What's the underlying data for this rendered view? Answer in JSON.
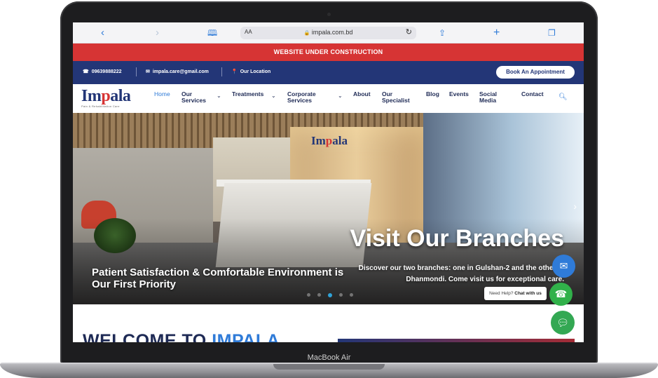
{
  "browser": {
    "text_size_label": "AA",
    "url": "impala.com.bd"
  },
  "banner": {
    "text": "WEBSITE UNDER CONSTRUCTION"
  },
  "infobar": {
    "phone": "09639888222",
    "email": "impala.care@gmail.com",
    "location": "Our Location",
    "book_button": "Book An Appointment"
  },
  "logo": {
    "name_prefix": "Im",
    "name_accent": "p",
    "name_suffix": "ala",
    "tagline": "Pain & Rehabilitation Care"
  },
  "nav": {
    "items": [
      {
        "label": "Home"
      },
      {
        "label": "Our Services"
      },
      {
        "label": "Treatments"
      },
      {
        "label": "Corporate Services"
      },
      {
        "label": "About"
      },
      {
        "label": "Our Specialist"
      },
      {
        "label": "Blog"
      },
      {
        "label": "Events"
      },
      {
        "label": "Social Media"
      },
      {
        "label": "Contact"
      }
    ]
  },
  "hero": {
    "title": "Visit Our Branches",
    "description": "Discover our two branches: one in Gulshan-2 and the other in Dhanmondi. Come visit us for exceptional care.",
    "left_caption": "Patient Satisfaction & Comfortable Environment is Our First Priority",
    "slides_total": 5,
    "active_slide": 3
  },
  "welcome": {
    "prefix": "WELCOME TO",
    "accent": "IMPALA"
  },
  "chat_widget": {
    "help_text": "Need Help?",
    "help_action": "Chat with us"
  },
  "device": {
    "label": "MacBook Air"
  }
}
